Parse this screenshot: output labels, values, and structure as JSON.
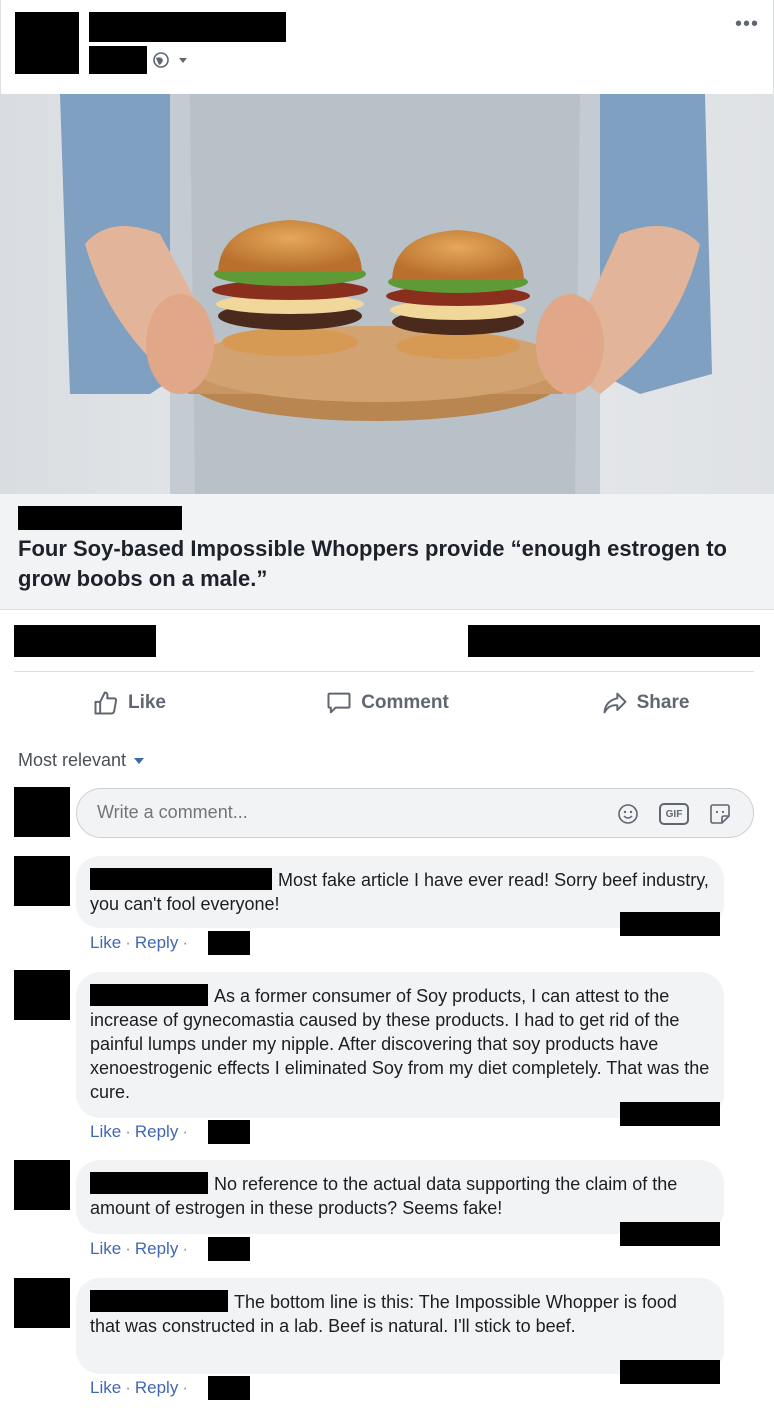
{
  "post": {
    "link_title": "Four Soy-based Impossible Whoppers provide “enough estrogen to grow boobs on a male.”"
  },
  "actions": {
    "like": "Like",
    "comment": "Comment",
    "share": "Share"
  },
  "comments_section": {
    "sort_label": "Most relevant",
    "write_placeholder": "Write a comment...",
    "gif_label": "GIF"
  },
  "comments": [
    {
      "text": "Most fake article I have ever read! Sorry beef industry, you can't fool everyone!",
      "like": "Like",
      "reply": "Reply"
    },
    {
      "text": "As a former consumer of Soy products, I can attest to the increase of gynecomastia caused by these products. I had to get rid of the painful lumps under my nipple. After discovering that soy products have xenoestrogenic effects I eliminated Soy from my diet completely. That was the cure.",
      "like": "Like",
      "reply": "Reply"
    },
    {
      "text": "No reference to the actual data supporting the claim of the amount of estrogen in these products? Seems fake!",
      "like": "Like",
      "reply": "Reply"
    },
    {
      "text": "The bottom line is this: The Impossible Whopper is food that was constructed in a lab. Beef is natural. I'll stick to beef.",
      "like": "Like",
      "reply": "Reply"
    }
  ],
  "colors": {
    "link_blue": "#4267b2",
    "muted": "#606770",
    "bubble": "#f2f3f5"
  },
  "icons": [
    "more-icon",
    "globe-icon",
    "like-icon",
    "comment-icon",
    "share-icon",
    "emoji-icon",
    "gif-icon",
    "sticker-icon"
  ]
}
